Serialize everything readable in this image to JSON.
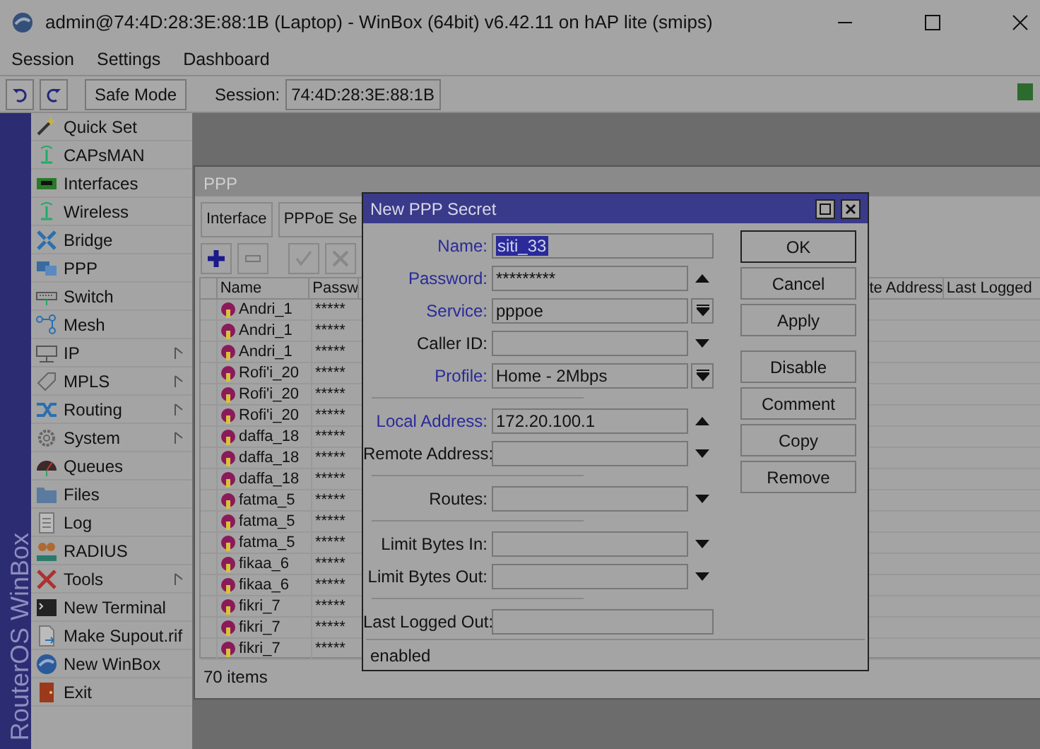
{
  "window": {
    "title": "admin@74:4D:28:3E:88:1B (Laptop) - WinBox (64bit) v6.42.11 on hAP lite (smips)"
  },
  "menu": [
    "Session",
    "Settings",
    "Dashboard"
  ],
  "toolbar": {
    "safe_mode": "Safe Mode",
    "session_label": "Session:",
    "session_value": "74:4D:28:3E:88:1B"
  },
  "sidebar": {
    "brand": "RouterOS WinBox",
    "items": [
      {
        "label": "Quick Set",
        "submenu": false
      },
      {
        "label": "CAPsMAN",
        "submenu": false
      },
      {
        "label": "Interfaces",
        "submenu": false
      },
      {
        "label": "Wireless",
        "submenu": false
      },
      {
        "label": "Bridge",
        "submenu": false
      },
      {
        "label": "PPP",
        "submenu": false
      },
      {
        "label": "Switch",
        "submenu": false
      },
      {
        "label": "Mesh",
        "submenu": false
      },
      {
        "label": "IP",
        "submenu": true
      },
      {
        "label": "MPLS",
        "submenu": true
      },
      {
        "label": "Routing",
        "submenu": true
      },
      {
        "label": "System",
        "submenu": true
      },
      {
        "label": "Queues",
        "submenu": false
      },
      {
        "label": "Files",
        "submenu": false
      },
      {
        "label": "Log",
        "submenu": false
      },
      {
        "label": "RADIUS",
        "submenu": false
      },
      {
        "label": "Tools",
        "submenu": true
      },
      {
        "label": "New Terminal",
        "submenu": false
      },
      {
        "label": "Make Supout.rif",
        "submenu": false
      },
      {
        "label": "New WinBox",
        "submenu": false
      },
      {
        "label": "Exit",
        "submenu": false
      }
    ]
  },
  "ppp_window": {
    "title": "PPP",
    "tabs": [
      "Interface",
      "PPPoE Se"
    ],
    "columns": [
      "Name",
      "Passw"
    ],
    "right_columns": [
      "te Address",
      "Last Logged"
    ],
    "rows": [
      {
        "name": "Andri_1",
        "password": "*****"
      },
      {
        "name": "Andri_1",
        "password": "*****"
      },
      {
        "name": "Andri_1",
        "password": "*****"
      },
      {
        "name": "Rofi'i_20",
        "password": "*****"
      },
      {
        "name": "Rofi'i_20",
        "password": "*****"
      },
      {
        "name": "Rofi'i_20",
        "password": "*****"
      },
      {
        "name": "daffa_18",
        "password": "*****"
      },
      {
        "name": "daffa_18",
        "password": "*****"
      },
      {
        "name": "daffa_18",
        "password": "*****"
      },
      {
        "name": "fatma_5",
        "password": "*****"
      },
      {
        "name": "fatma_5",
        "password": "*****"
      },
      {
        "name": "fatma_5",
        "password": "*****"
      },
      {
        "name": "fikaa_6",
        "password": "*****"
      },
      {
        "name": "fikaa_6",
        "password": "*****"
      },
      {
        "name": "fikri_7",
        "password": "*****"
      },
      {
        "name": "fikri_7",
        "password": "*****"
      },
      {
        "name": "fikri_7",
        "password": "*****"
      }
    ],
    "status": "70 items"
  },
  "dialog": {
    "title": "New PPP Secret",
    "groups": [
      [
        {
          "label": "Name:",
          "value": "siti_33",
          "kind": "wide",
          "emphasized": true,
          "selected": true
        },
        {
          "label": "Password:",
          "value": "*********",
          "kind": "up",
          "emphasized": true,
          "selected": false
        },
        {
          "label": "Service:",
          "value": "pppoe",
          "kind": "combo",
          "emphasized": true,
          "selected": false
        },
        {
          "label": "Caller ID:",
          "kind": "down",
          "emphasized": false
        },
        {
          "label": "Profile:",
          "value": "Home - 2Mbps",
          "kind": "combo",
          "emphasized": true,
          "selected": false
        }
      ],
      [
        {
          "label": "Local Address:",
          "value": "172.20.100.1",
          "kind": "up",
          "emphasized": true,
          "selected": false
        },
        {
          "label": "Remote Address:",
          "kind": "down",
          "emphasized": false
        }
      ],
      [
        {
          "label": "Routes:",
          "kind": "down",
          "emphasized": false
        }
      ],
      [
        {
          "label": "Limit Bytes In:",
          "kind": "down",
          "emphasized": false
        },
        {
          "label": "Limit Bytes Out:",
          "kind": "down",
          "emphasized": false
        }
      ],
      [
        {
          "label": "Last Logged Out:",
          "kind": "wide",
          "emphasized": false
        }
      ]
    ],
    "buttons": [
      [
        "OK",
        "Cancel",
        "Apply"
      ],
      [
        "Disable",
        "Comment",
        "Copy",
        "Remove"
      ]
    ],
    "status": "enabled"
  }
}
